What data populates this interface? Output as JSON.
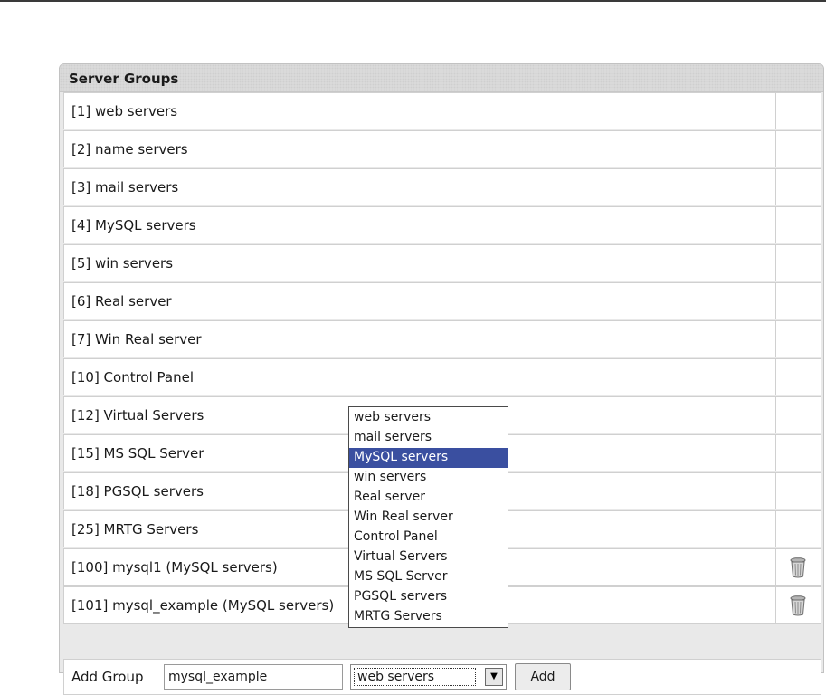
{
  "panel": {
    "title": "Server Groups"
  },
  "groups": [
    {
      "label": "[1] web servers",
      "deletable": false
    },
    {
      "label": "[2] name servers",
      "deletable": false
    },
    {
      "label": "[3] mail servers",
      "deletable": false
    },
    {
      "label": "[4] MySQL servers",
      "deletable": false
    },
    {
      "label": "[5] win servers",
      "deletable": false
    },
    {
      "label": "[6] Real server",
      "deletable": false
    },
    {
      "label": "[7] Win Real server",
      "deletable": false
    },
    {
      "label": "[10] Control Panel",
      "deletable": false
    },
    {
      "label": "[12] Virtual Servers",
      "deletable": false
    },
    {
      "label": "[15] MS SQL Server",
      "deletable": false
    },
    {
      "label": "[18] PGSQL servers",
      "deletable": false
    },
    {
      "label": "[25] MRTG Servers",
      "deletable": false
    },
    {
      "label": "[100] mysql1 (MySQL servers)",
      "deletable": true
    },
    {
      "label": "[101] mysql_example (MySQL servers)",
      "deletable": true
    }
  ],
  "add_group": {
    "label": "Add Group",
    "input_value": "mysql_example",
    "select_value": "web servers",
    "button_label": "Add"
  },
  "dropdown": {
    "options": [
      "web servers",
      "mail servers",
      "MySQL servers",
      "win servers",
      "Real server",
      "Win Real server",
      "Control Panel",
      "Virtual Servers",
      "MS SQL Server",
      "PGSQL servers",
      "MRTG Servers"
    ],
    "highlighted": "MySQL servers"
  },
  "colors": {
    "highlight": "#3a4fa0",
    "header_bg": "#dcdcdc",
    "row_bg": "#ffffff"
  },
  "icons": {
    "delete": "trash-icon",
    "select_arrow": "chevron-down-icon"
  }
}
